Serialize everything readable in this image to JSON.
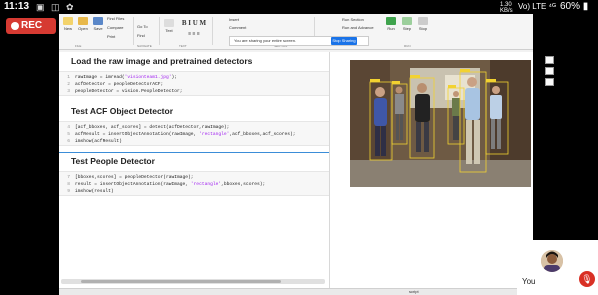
{
  "status_bar": {
    "time": "11:13",
    "icons": "▣ ◫ ✿",
    "speed": "1.30\nKB/s",
    "network": "Vo) LTE ⁴ᴳ",
    "battery": "60%"
  },
  "recording": {
    "label": "REC"
  },
  "ribbon": {
    "groups": [
      "FILE",
      "NAVIGATE",
      "TEXT",
      "SECTION",
      "RUN"
    ],
    "buttons": [
      "New",
      "Open",
      "Save",
      "Find Files",
      "Compare",
      "Print",
      "Go To",
      "Find",
      "Insert",
      "Comment",
      "Indent",
      "Text",
      "Breakpoints",
      "Run",
      "Run and Advance",
      "Run Section",
      "Step",
      "Stop"
    ],
    "share_message": "You are sharing your entire screen.",
    "stop_sharing": "Stop Sharing"
  },
  "live_script": {
    "sections": [
      {
        "title": "Load the raw image and pretrained detectors",
        "lines": [
          {
            "n": "1",
            "pre": "rawImage = imread(",
            "str": "'visionteam1.jpg'",
            "post": ");"
          },
          {
            "n": "2",
            "pre": "acfDetector = peopleDetectorACF;",
            "str": "",
            "post": ""
          },
          {
            "n": "3",
            "pre": "peopleDetector = vision.PeopleDetector;",
            "str": "",
            "post": ""
          }
        ]
      },
      {
        "title": "Test ACF Object Detector",
        "lines": [
          {
            "n": "4",
            "pre": "[acf_bboxes, acf_scores] = detect(acfDetector,rawImage);",
            "str": "",
            "post": ""
          },
          {
            "n": "5",
            "pre": "acfResult = insertObjectAnnotation(rawImage, ",
            "str": "'rectangle'",
            "post": ",acf_bboxes,acf_scores);"
          },
          {
            "n": "6",
            "pre": "imshow(acfResult)",
            "str": "",
            "post": ""
          }
        ]
      },
      {
        "title": "Test People Detector",
        "lines": [
          {
            "n": "7",
            "pre": "[bboxes,scores] = peopleDetector(rawImage);",
            "str": "",
            "post": ""
          },
          {
            "n": "8",
            "pre": "result = insertObjectAnnotation(rawImage, ",
            "str": "'rectangle'",
            "post": ",bboxes,scores);"
          },
          {
            "n": "9",
            "pre": "imshow(result)",
            "str": "",
            "post": ""
          }
        ]
      }
    ]
  },
  "status": {
    "mode": "script"
  },
  "participant": {
    "name": "You",
    "mic_state": "muted"
  },
  "colors": {
    "rec": "#d63a32",
    "detection_box": "#f2d230",
    "mic_off": "#d93025",
    "string": "#a020f0"
  }
}
